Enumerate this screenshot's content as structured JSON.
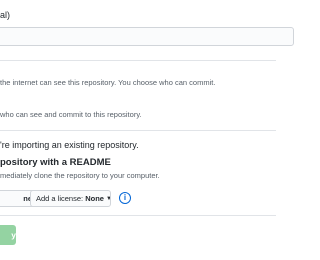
{
  "description": {
    "label_fragment": "al)"
  },
  "visibility": {
    "public_description": "the internet can see this repository. You choose who can commit.",
    "private_description": " who can see and commit to this repository."
  },
  "initialize": {
    "skip_text": "'re importing an existing repository.",
    "readme_title": "pository with a README",
    "readme_description": "mediately clone the repository to your computer."
  },
  "gitignore": {
    "selected_value": "ne"
  },
  "license": {
    "label": "Add a license:",
    "selected_value": "None"
  },
  "icons": {
    "info": "info-icon",
    "caret": "caret-down-icon"
  },
  "create_button": {
    "label": "y"
  },
  "colors": {
    "accent_blue": "#0366d6",
    "create_button_disabled": "#94d3a2",
    "muted_text": "#586069"
  }
}
